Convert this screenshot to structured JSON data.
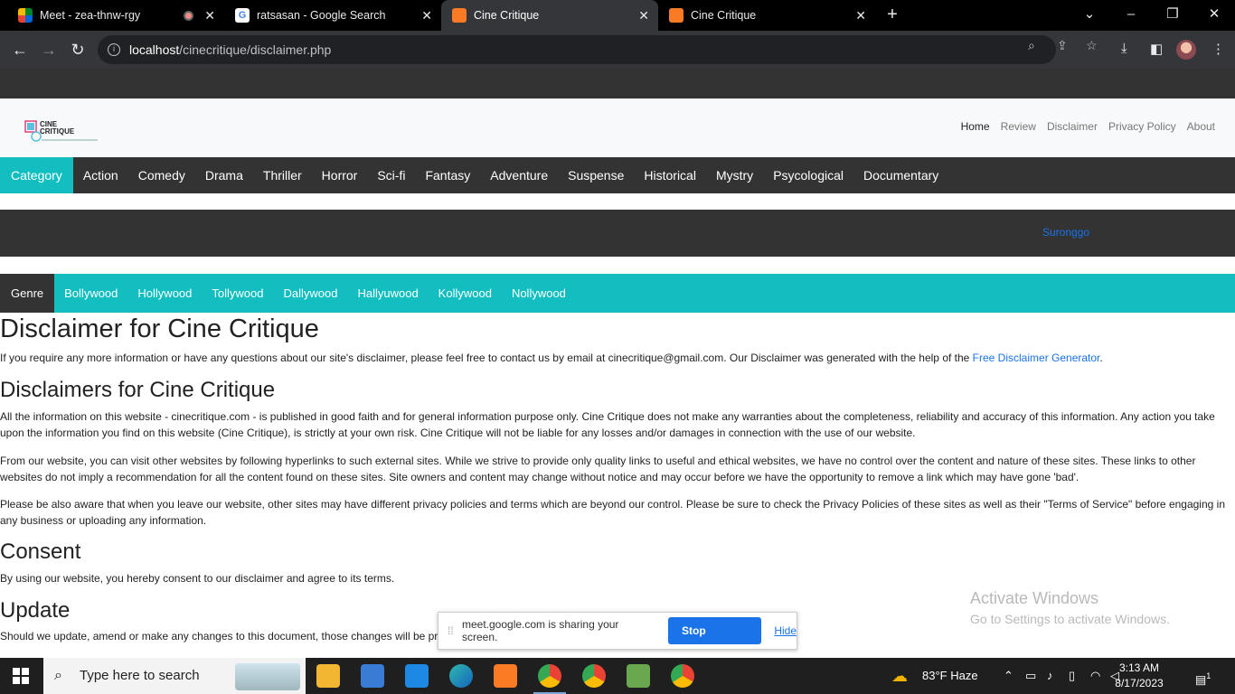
{
  "browser": {
    "tabs": [
      {
        "title": "Meet - zea-thnw-rgy",
        "recording": true
      },
      {
        "title": "ratsasan - Google Search"
      },
      {
        "title": "Cine Critique",
        "active": true
      },
      {
        "title": "Cine Critique"
      }
    ],
    "address": {
      "host": "localhost",
      "path": "/cinecritique/disclaimer.php"
    }
  },
  "site": {
    "logo_text": "CINE\nCRITIQUE",
    "top_nav": [
      "Home",
      "Review",
      "Disclaimer",
      "Privacy Policy",
      "About"
    ],
    "categories": [
      "Category",
      "Action",
      "Comedy",
      "Drama",
      "Thriller",
      "Horror",
      "Sci-fi",
      "Fantasy",
      "Adventure",
      "Suspense",
      "Historical",
      "Mystry",
      "Psycological",
      "Documentary"
    ],
    "band_link": "Suronggo",
    "genres": [
      "Genre",
      "Bollywood",
      "Hollywood",
      "Tollywood",
      "Dallywood",
      "Hallyuwood",
      "Kollywood",
      "Nollywood"
    ]
  },
  "content": {
    "h1": "Disclaimer for Cine Critique",
    "p1_text": "If you require any more information or have any questions about our site's disclaimer, please feel free to contact us by email at cinecritique@gmail.com. Our Disclaimer was generated with the help of the ",
    "p1_link": "Free Disclaimer Generator",
    "p1_end": ".",
    "h2a": "Disclaimers for Cine Critique",
    "p2": "All the information on this website - cinecritique.com - is published in good faith and for general information purpose only. Cine Critique does not make any warranties about the completeness, reliability and accuracy of this information. Any action you take upon the information you find on this website (Cine Critique), is strictly at your own risk. Cine Critique will not be liable for any losses and/or damages in connection with the use of our website.",
    "p3": "From our website, you can visit other websites by following hyperlinks to such external sites. While we strive to provide only quality links to useful and ethical websites, we have no control over the content and nature of these sites. These links to other websites do not imply a recommendation for all the content found on these sites. Site owners and content may change without notice and may occur before we have the opportunity to remove a link which may have gone 'bad'.",
    "p4": "Please be also aware that when you leave our website, other sites may have different privacy policies and terms which are beyond our control. Please be sure to check the Privacy Policies of these sites as well as their \"Terms of Service\" before engaging in any business or uploading any information.",
    "h2b": "Consent",
    "p5": "By using our website, you hereby consent to our disclaimer and agree to its terms.",
    "h2c": "Update",
    "p6": "Should we update, amend or make any changes to this document, those changes will be pr"
  },
  "overlay": {
    "watermark_title": "Activate Windows",
    "watermark_sub": "Go to Settings to activate Windows.",
    "share_text": "meet.google.com is sharing your screen.",
    "stop_label": "Stop sharing",
    "hide_label": "Hide"
  },
  "taskbar": {
    "search_placeholder": "Type here to search",
    "weather": "83°F  Haze",
    "time": "3:13 AM",
    "date": "8/17/2023",
    "notifications": "1"
  },
  "colors": {
    "accent": "#13bec1",
    "dark": "#333333",
    "link": "#1a73e8"
  }
}
